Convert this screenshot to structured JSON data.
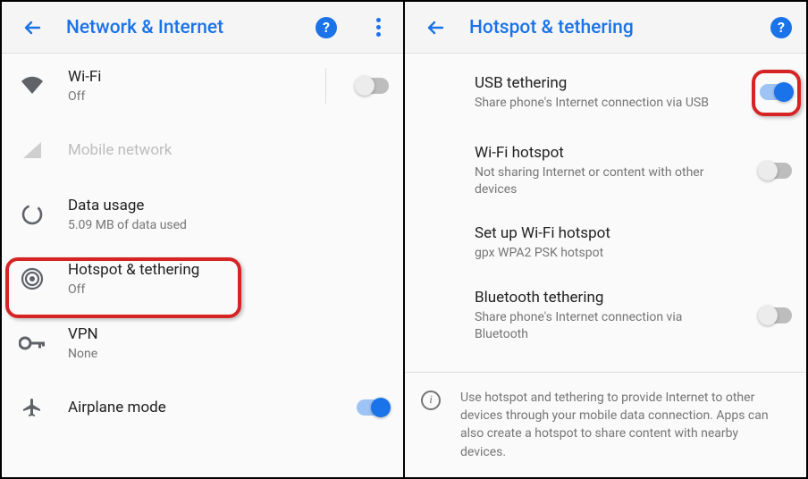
{
  "left": {
    "title": "Network & Internet",
    "items": {
      "wifi": {
        "label": "Wi-Fi",
        "sub": "Off"
      },
      "mobile": {
        "label": "Mobile network"
      },
      "data": {
        "label": "Data usage",
        "sub": "5.09 MB of data used"
      },
      "hotspot": {
        "label": "Hotspot & tethering",
        "sub": "Off"
      },
      "vpn": {
        "label": "VPN",
        "sub": "None"
      },
      "airplane": {
        "label": "Airplane mode"
      }
    }
  },
  "right": {
    "title": "Hotspot & tethering",
    "items": {
      "usb": {
        "label": "USB tethering",
        "sub": "Share phone's Internet connection via USB"
      },
      "wifihs": {
        "label": "Wi-Fi hotspot",
        "sub": "Not sharing Internet or content with other devices"
      },
      "setup": {
        "label": "Set up Wi-Fi hotspot",
        "sub": "gpx WPA2 PSK hotspot"
      },
      "bt": {
        "label": "Bluetooth tethering",
        "sub": "Share phone's Internet connection via Bluetooth"
      }
    },
    "info": "Use hotspot and tethering to provide Internet to other devices through your mobile data connection. Apps can also create a hotspot to share content with nearby devices."
  }
}
